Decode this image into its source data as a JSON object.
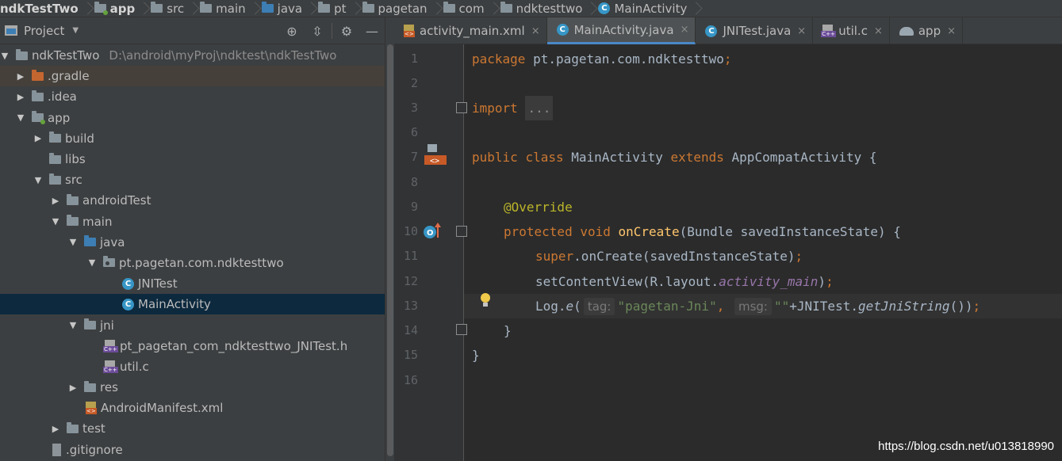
{
  "breadcrumb": {
    "items": [
      "ndkTestTwo",
      "app",
      "src",
      "main",
      "java",
      "pt",
      "pagetan",
      "com",
      "ndktesttwo",
      "MainActivity"
    ]
  },
  "project_panel": {
    "title": "Project",
    "tree": [
      {
        "label": "ndkTestTwo",
        "path": "D:\\android\\myProj\\ndktest\\ndkTestTwo"
      },
      {
        "label": ".gradle"
      },
      {
        "label": ".idea"
      },
      {
        "label": "app"
      },
      {
        "label": "build"
      },
      {
        "label": "libs"
      },
      {
        "label": "src"
      },
      {
        "label": "androidTest"
      },
      {
        "label": "main"
      },
      {
        "label": "java"
      },
      {
        "label": "pt.pagetan.com.ndktesttwo"
      },
      {
        "label": "JNITest"
      },
      {
        "label": "MainActivity"
      },
      {
        "label": "jni"
      },
      {
        "label": "pt_pagetan_com_ndktesttwo_JNITest.h"
      },
      {
        "label": "util.c"
      },
      {
        "label": "res"
      },
      {
        "label": "AndroidManifest.xml"
      },
      {
        "label": "test"
      },
      {
        "label": ".gitignore"
      }
    ]
  },
  "tabs": [
    {
      "label": "activity_main.xml",
      "close": "×"
    },
    {
      "label": "MainActivity.java",
      "close": "×"
    },
    {
      "label": "JNITest.java",
      "close": "×"
    },
    {
      "label": "util.c",
      "close": "×"
    },
    {
      "label": "app",
      "close": "×"
    }
  ],
  "editor": {
    "line_numbers": [
      "1",
      "2",
      "3",
      "6",
      "7",
      "8",
      "9",
      "10",
      "11",
      "12",
      "13",
      "14",
      "15",
      "16"
    ],
    "code": {
      "l1_kw": "package",
      "l1_rest": " pt.pagetan.com.ndktesttwo",
      "l1_semi": ";",
      "l3_kw": "import",
      "l3_fold": "...",
      "l7_kw1": "public",
      "l7_kw2": "class",
      "l7_name": " MainActivity ",
      "l7_kw3": "extends",
      "l7_rest": " AppCompatActivity {",
      "l9_ann": "@Override",
      "l10_kw1": "protected",
      "l10_kw2": "void",
      "l10_fn": "onCreate",
      "l10_rest": "(Bundle savedInstanceState) {",
      "l11_kw": "super",
      "l11_rest": ".onCreate(savedInstanceState)",
      "l11_semi": ";",
      "l12_a": "setContentView(R.layout.",
      "l12_field": "activity_main",
      "l12_b": ")",
      "l12_semi": ";",
      "l13_a": "Log.",
      "l13_e": "e",
      "l13_paren": "(",
      "l13_hint1": "tag:",
      "l13_str1": "\"pagetan-Jni\"",
      "l13_comma": ",",
      "l13_hint2": "msg:",
      "l13_str2": "\"\"",
      "l13_b": "+JNITest.",
      "l13_fn": "getJniString",
      "l13_c": "())",
      "l13_semi": ";",
      "l14": "}",
      "l15": "}"
    }
  },
  "watermark": "https://blog.csdn.net/u013818990",
  "colors": {
    "keyword": "#cc7832",
    "annotation": "#bbb529",
    "string": "#6a8759",
    "method": "#ffc66d",
    "field": "#9876aa",
    "selection": "#0d293e",
    "tab_underline": "#4a88c7"
  }
}
